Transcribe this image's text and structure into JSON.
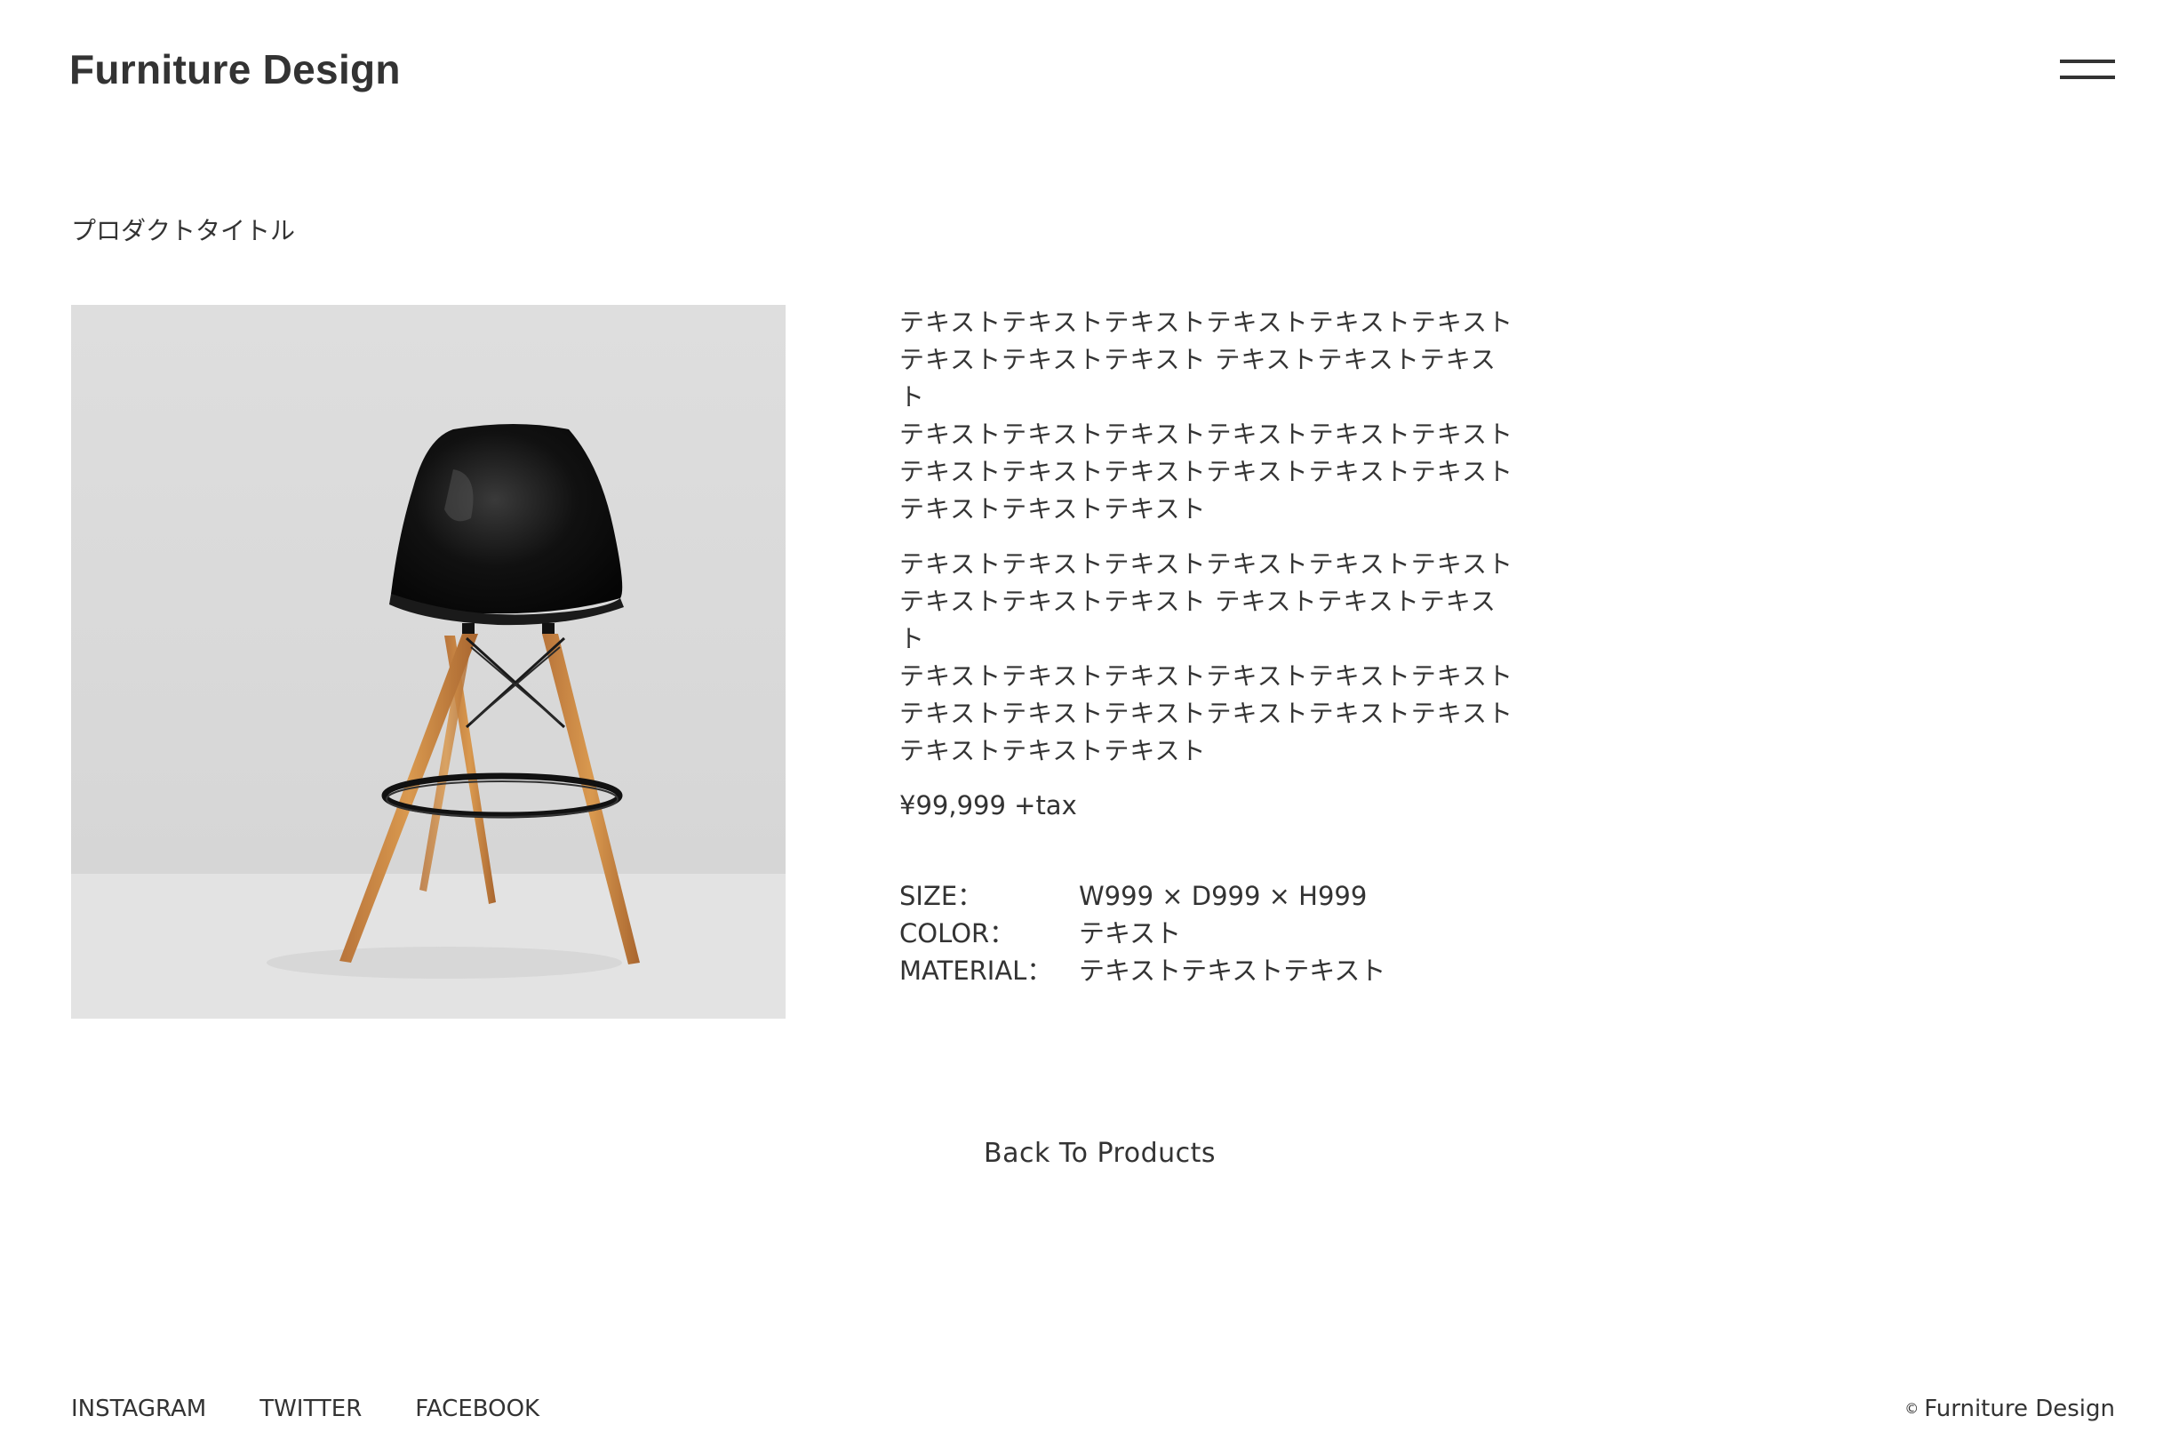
{
  "header": {
    "logo": "Furniture Design",
    "menu_icon": "hamburger-menu-icon"
  },
  "product": {
    "title": "プロダクトタイトル",
    "image_icon": "chair-photo",
    "description_1": [
      "テキストテキストテキストテキストテキストテキスト",
      "テキストテキストテキスト テキストテキストテキスト",
      "テキストテキストテキストテキストテキストテキスト",
      "テキストテキストテキストテキストテキストテキスト",
      "テキストテキストテキスト"
    ],
    "description_2": [
      "テキストテキストテキストテキストテキストテキスト",
      "テキストテキストテキスト テキストテキストテキスト",
      "テキストテキストテキストテキストテキストテキスト",
      "テキストテキストテキストテキストテキストテキスト",
      "テキストテキストテキスト"
    ],
    "price": "¥99,999 +tax",
    "specs": [
      {
        "label": "SIZE：",
        "value": "W999 × D999 × H999"
      },
      {
        "label": "COLOR：",
        "value": "テキスト"
      },
      {
        "label": "MATERIAL：",
        "value": "テキストテキストテキスト"
      }
    ]
  },
  "back_link": "Back To Products",
  "footer": {
    "links": [
      "INSTAGRAM",
      "TWITTER",
      "FACEBOOK"
    ],
    "copyright_mark": "©",
    "copyright_text": "Furniture Design"
  }
}
